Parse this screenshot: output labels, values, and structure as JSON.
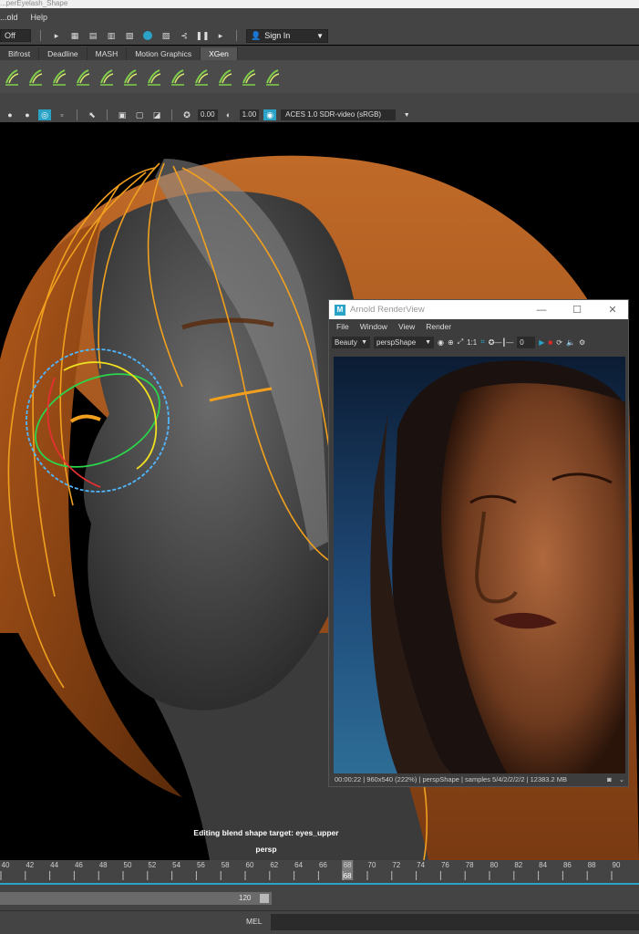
{
  "window": {
    "title_fragment": "...perEyelash_Shape"
  },
  "menubar": {
    "items": [
      "...old",
      "Help"
    ]
  },
  "status_line": {
    "combo_value": "Off",
    "sign_in_label": "Sign In"
  },
  "shelf": {
    "tabs": [
      "Bifrost",
      "Deadline",
      "MASH",
      "Motion Graphics",
      "XGen"
    ],
    "active_tab": "XGen",
    "icons": [
      "xgen-tool-1",
      "xgen-tool-2",
      "xgen-tool-3",
      "xgen-tool-4",
      "xgen-tool-5",
      "xgen-tool-6",
      "xgen-tool-7",
      "xgen-tool-8",
      "xgen-tool-9",
      "xgen-tool-10",
      "xgen-tool-11",
      "xgen-tool-12"
    ]
  },
  "viewport_toolbar": {
    "exposure_value": "0.00",
    "gamma_value": "1.00",
    "color_space": "ACES 1.0 SDR-video (sRGB)"
  },
  "viewport": {
    "hud_message": "Editing blend shape target: eyes_upper",
    "camera_label": "persp"
  },
  "arnold_renderview": {
    "title": "Arnold RenderView",
    "menu": [
      "File",
      "Window",
      "View",
      "Render"
    ],
    "aov": "Beauty",
    "camera": "perspShape",
    "ratio_label": "1:1",
    "slider_value": "0",
    "status": "00:00:22 | 960x540 (222%) | perspShape  | samples 5/4/2/2/2/2 | 12383.2 MB"
  },
  "timeline": {
    "tick_labels": [
      "40",
      "42",
      "44",
      "46",
      "48",
      "50",
      "52",
      "54",
      "56",
      "58",
      "60",
      "62",
      "64",
      "66",
      "68",
      "70",
      "72",
      "74",
      "76",
      "78",
      "80",
      "82",
      "84",
      "86",
      "88",
      "90"
    ],
    "current_frame": "68"
  },
  "range_slider": {
    "end_value": "120"
  },
  "command_line": {
    "language": "MEL"
  },
  "colors": {
    "ui_bg": "#444444",
    "viewport_bg": "#000000",
    "accent_blue": "#2aa3c6",
    "guide_orange": "#f0a01e",
    "shelf_green": "#7fd14a"
  }
}
